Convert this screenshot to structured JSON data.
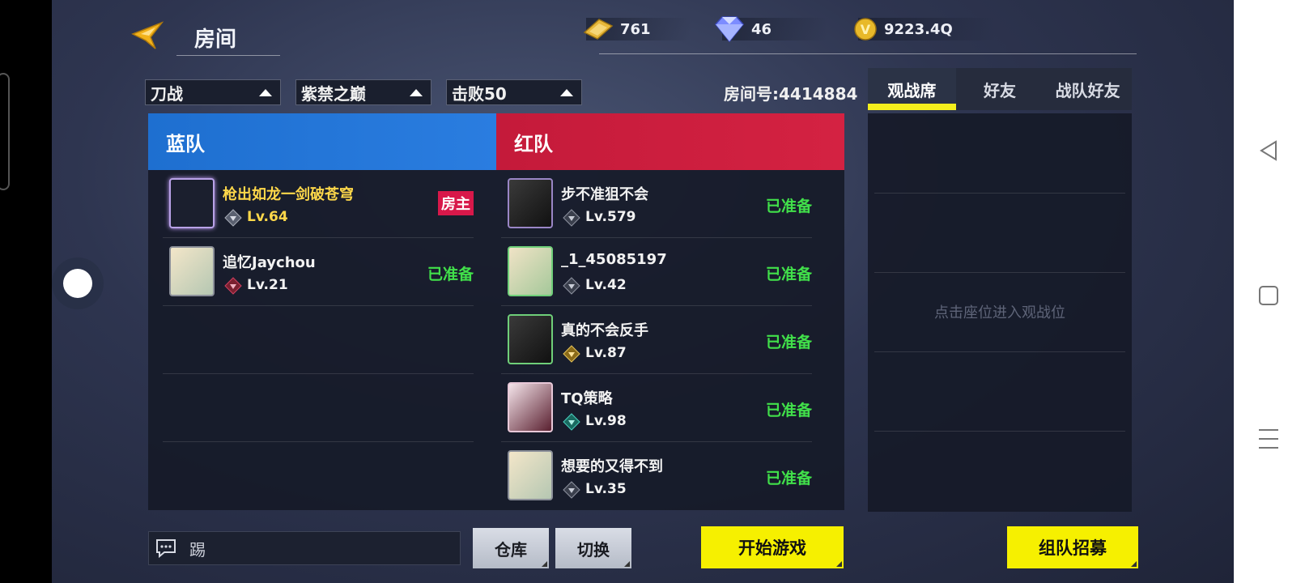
{
  "header": {
    "title": "房间",
    "currencies": [
      {
        "name": "gold-ticket",
        "amount": "761"
      },
      {
        "name": "diamond",
        "amount": "46"
      },
      {
        "name": "v-coin",
        "amount": "9223.4Q"
      }
    ]
  },
  "filters": {
    "mode": "刀战",
    "map": "紫禁之巅",
    "goal": "击败50"
  },
  "room_id": "房间号:4414884",
  "blue_team": {
    "label": "蓝队",
    "players": [
      {
        "name": "枪出如龙一剑破苍穹",
        "level": "Lv.64",
        "badge": "房主"
      },
      {
        "name": "追忆Jaychou",
        "level": "Lv.21",
        "status": "已准备"
      }
    ]
  },
  "red_team": {
    "label": "红队",
    "players": [
      {
        "name": "步不准狙不会",
        "level": "Lv.579",
        "status": "已准备"
      },
      {
        "name": "_1_45085197",
        "level": "Lv.42",
        "status": "已准备"
      },
      {
        "name": "真的不会反手",
        "level": "Lv.87",
        "status": "已准备"
      },
      {
        "name": "TQ策略",
        "level": "Lv.98",
        "status": "已准备"
      },
      {
        "name": "想要的又得不到",
        "level": "Lv.35",
        "status": "已准备"
      }
    ]
  },
  "side_tabs": [
    "观战席",
    "好友",
    "战队好友"
  ],
  "spectator_hint": "点击座位进入观战位",
  "chat": {
    "text": "踢"
  },
  "buttons": {
    "warehouse": "仓库",
    "switch": "切换",
    "start": "开始游戏",
    "recruit": "组队招募"
  },
  "colors": {
    "blue_team": "#1e6fd0",
    "red_team": "#c41a3a",
    "ready": "#41e04a",
    "accent_yellow": "#f6f000",
    "host": "#d8184a"
  }
}
